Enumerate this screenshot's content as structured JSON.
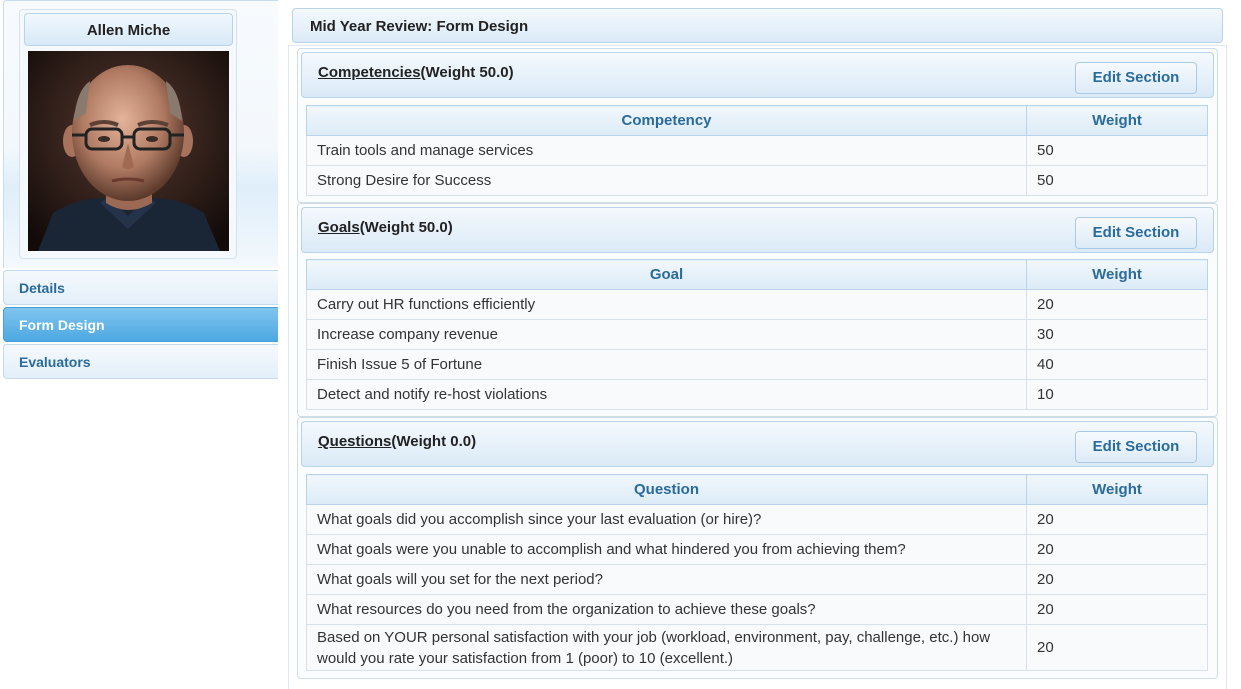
{
  "profile": {
    "name": "Allen Miche"
  },
  "nav": {
    "items": [
      {
        "label": "Details"
      },
      {
        "label": "Form Design"
      },
      {
        "label": "Evaluators"
      }
    ],
    "active_index": 1
  },
  "main": {
    "title": "Mid Year Review: Form Design"
  },
  "sections": [
    {
      "title": "Competencies",
      "weight_text": "(Weight 50.0)",
      "edit_label": "Edit Section",
      "col1": "Competency",
      "col2": "Weight",
      "rows": [
        {
          "name": "Train tools and manage services",
          "weight": "50"
        },
        {
          "name": "Strong Desire for Success",
          "weight": "50"
        }
      ]
    },
    {
      "title": "Goals",
      "weight_text": "(Weight 50.0)",
      "edit_label": "Edit Section",
      "col1": "Goal",
      "col2": "Weight",
      "rows": [
        {
          "name": "Carry out HR functions efficiently",
          "weight": "20"
        },
        {
          "name": "Increase company revenue",
          "weight": "30"
        },
        {
          "name": "Finish Issue 5 of Fortune",
          "weight": "40"
        },
        {
          "name": "Detect and notify re-host violations",
          "weight": "10"
        }
      ]
    },
    {
      "title": "Questions",
      "weight_text": "(Weight 0.0)",
      "edit_label": "Edit Section",
      "col1": "Question",
      "col2": "Weight",
      "rows": [
        {
          "name": "What goals did you accomplish since your last evaluation (or hire)?",
          "weight": "20"
        },
        {
          "name": "What goals were you unable to accomplish and what hindered you from achieving them?",
          "weight": "20"
        },
        {
          "name": "What goals will you set for the next period?",
          "weight": "20"
        },
        {
          "name": "What resources do you need from the organization to achieve these goals?",
          "weight": "20"
        },
        {
          "name": "Based on YOUR personal satisfaction with your job (workload, environment, pay, challenge, etc.) how would you rate your satisfaction from 1 (poor) to 10 (excellent.)",
          "weight": "20"
        }
      ]
    }
  ]
}
